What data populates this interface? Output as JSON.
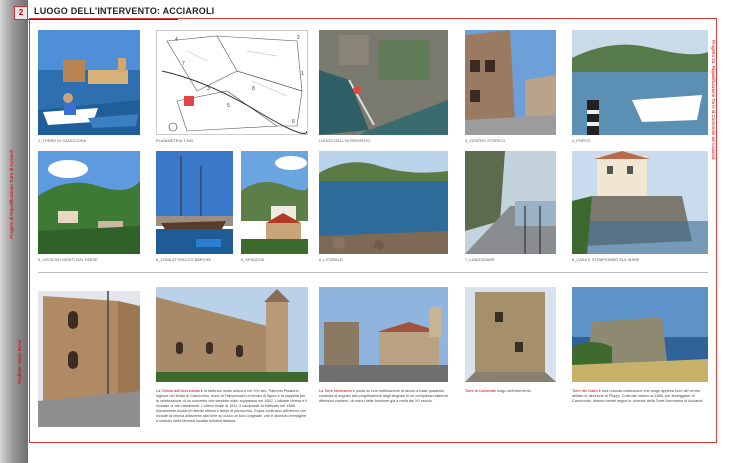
{
  "page": {
    "number": "2",
    "title": "LUOGO DELL'INTERVENTO: ACCIAROLI",
    "spine_texts": [
      "Progetto di Riqualificazione Torre di Acciaroli",
      "Studente: Mario Rossi"
    ],
    "side_text": "Progetto 2a: Riqualificazione Torre di Cantonale ad Acciaroli"
  },
  "row1": [
    {
      "caption": "1_TORRE DI CANOCCHIA"
    },
    {
      "caption": "PLANIMETRIA 1:500"
    },
    {
      "caption": "LUOGO DELL'INTERVENTO"
    },
    {
      "caption": "3_CENTRO STORICO"
    },
    {
      "caption": "4_PORTO"
    }
  ],
  "row2": [
    {
      "caption": "5_VISTA DEI MONTI DAL PAESE"
    },
    {
      "caption": "6_ZONA ATTRACCO BARCHE"
    },
    {
      "caption": "6_SPIAGGIA"
    },
    {
      "caption": "6_LITORALE"
    },
    {
      "caption": "7_LUNGOMARE"
    },
    {
      "caption": "8_CASA E STRAPIOMBO SUL MARE"
    }
  ],
  "map_labels": [
    "4",
    "3",
    "2",
    "1",
    "7",
    "8",
    "5",
    "6"
  ],
  "row3": [
    {
      "highlight": "La Chiesa dell'Annunziata",
      "text": " è la fabbrica molto antica e nel XVI sec. Patronio Pisatone, signore del feudo di Cannicchio, donò ai Francescani un lembo di figura e la cappella per la celebrazione di un convento che sarebbe stato soppresso nel 1652. L'attuale chiesa è il risultato di vari rifacimenti. L'ultimo risale al 1911. Il campanile fu edificato nel 1888. Attualmente Acciaroli risente riflessi e tempi di parrocchia. Sopra confinano all'interno che include la chiesa adiacente alla torre su cuoio un tono originale, che è divenuto immagine e simbolo della famosa località turistica italiana."
    },
    {
      "highlight": "La Torre Normanna",
      "text": " è posta su una fortificazione di tavolo a base quadrata, costruita al seguito alla progettazione degli Angioini in un complesso sistema difensivo costiero, di misuri delle funzione già a metà del XII secolo."
    },
    {
      "highlight": "Torre di Cantonale",
      "text": " luogo dell'intervento"
    },
    {
      "highlight": "Torre del Caleo",
      "text": " è una robusta costruzione che sorge appena fuori del centro abitato in direzione di Pioppi. Costruita intorno al 1560, per festeggiare di Cannicchio, dimora mente segue le vicende della Torre Normanna di Acciaroli."
    }
  ]
}
